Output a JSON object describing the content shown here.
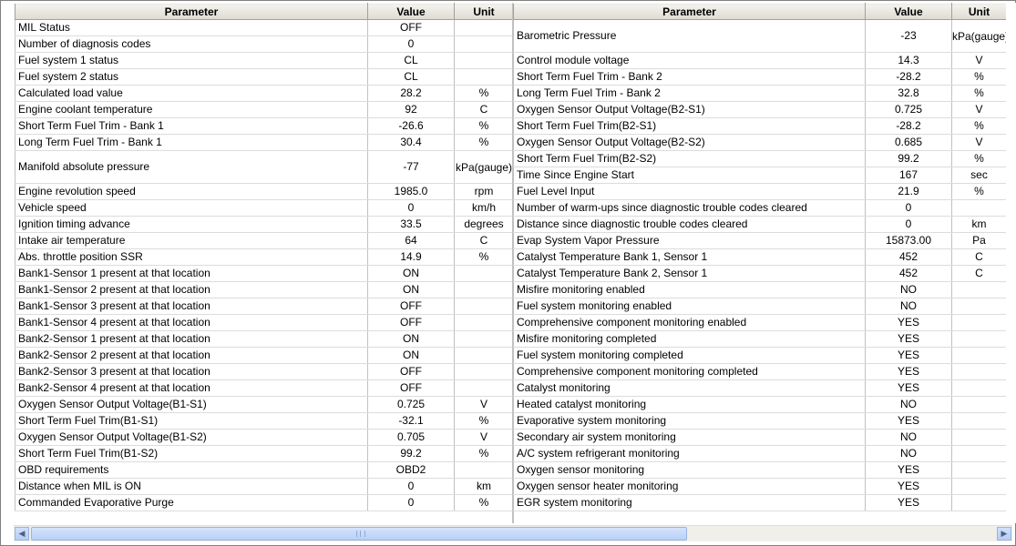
{
  "headers": {
    "parameter": "Parameter",
    "value": "Value",
    "unit": "Unit"
  },
  "left_rows": [
    {
      "p": "MIL Status",
      "v": "OFF",
      "u": ""
    },
    {
      "p": "Number of diagnosis codes",
      "v": "0",
      "u": ""
    },
    {
      "p": "Fuel system 1 status",
      "v": "CL",
      "u": ""
    },
    {
      "p": "Fuel system 2 status",
      "v": "CL",
      "u": ""
    },
    {
      "p": "Calculated load value",
      "v": "28.2",
      "u": "%"
    },
    {
      "p": "Engine coolant temperature",
      "v": "92",
      "u": "C"
    },
    {
      "p": "Short Term Fuel Trim - Bank 1",
      "v": "-26.6",
      "u": "%"
    },
    {
      "p": "Long Term Fuel Trim - Bank 1",
      "v": "30.4",
      "u": "%"
    },
    {
      "p": "Manifold absolute pressure",
      "v": "-77",
      "u": "kPa(gauge)",
      "tall": true
    },
    {
      "p": "Engine revolution speed",
      "v": "1985.0",
      "u": "rpm"
    },
    {
      "p": "Vehicle speed",
      "v": "0",
      "u": "km/h"
    },
    {
      "p": "Ignition timing advance",
      "v": "33.5",
      "u": "degrees"
    },
    {
      "p": "Intake air temperature",
      "v": "64",
      "u": "C"
    },
    {
      "p": "Abs. throttle position SSR",
      "v": "14.9",
      "u": "%"
    },
    {
      "p": "Bank1-Sensor 1 present at that location",
      "v": "ON",
      "u": ""
    },
    {
      "p": "Bank1-Sensor 2 present at that location",
      "v": "ON",
      "u": ""
    },
    {
      "p": "Bank1-Sensor 3 present at that location",
      "v": "OFF",
      "u": ""
    },
    {
      "p": "Bank1-Sensor 4 present at that location",
      "v": "OFF",
      "u": ""
    },
    {
      "p": "Bank2-Sensor 1 present at that location",
      "v": "ON",
      "u": ""
    },
    {
      "p": "Bank2-Sensor 2 present at that location",
      "v": "ON",
      "u": ""
    },
    {
      "p": "Bank2-Sensor 3 present at that location",
      "v": "OFF",
      "u": ""
    },
    {
      "p": "Bank2-Sensor 4 present at that location",
      "v": "OFF",
      "u": ""
    },
    {
      "p": "Oxygen Sensor Output Voltage(B1-S1)",
      "v": "0.725",
      "u": "V"
    },
    {
      "p": "Short Term Fuel Trim(B1-S1)",
      "v": "-32.1",
      "u": "%"
    },
    {
      "p": "Oxygen Sensor Output Voltage(B1-S2)",
      "v": "0.705",
      "u": "V"
    },
    {
      "p": "Short Term Fuel Trim(B1-S2)",
      "v": "99.2",
      "u": "%"
    },
    {
      "p": "OBD requirements",
      "v": "OBD2",
      "u": ""
    },
    {
      "p": "Distance when MIL is ON",
      "v": "0",
      "u": "km"
    },
    {
      "p": "Commanded Evaporative Purge",
      "v": "0",
      "u": "%"
    }
  ],
  "right_rows": [
    {
      "p": "Barometric Pressure",
      "v": "-23",
      "u": "kPa(gauge)",
      "tall": true
    },
    {
      "p": "Control module voltage",
      "v": "14.3",
      "u": "V"
    },
    {
      "p": "Short Term Fuel Trim - Bank 2",
      "v": "-28.2",
      "u": "%"
    },
    {
      "p": "Long Term Fuel Trim - Bank 2",
      "v": "32.8",
      "u": "%"
    },
    {
      "p": "Oxygen Sensor Output Voltage(B2-S1)",
      "v": "0.725",
      "u": "V"
    },
    {
      "p": "Short Term Fuel Trim(B2-S1)",
      "v": "-28.2",
      "u": "%"
    },
    {
      "p": "Oxygen Sensor Output Voltage(B2-S2)",
      "v": "0.685",
      "u": "V"
    },
    {
      "p": "Short Term Fuel Trim(B2-S2)",
      "v": "99.2",
      "u": "%"
    },
    {
      "p": "Time Since Engine Start",
      "v": "167",
      "u": "sec"
    },
    {
      "p": "Fuel Level Input",
      "v": "21.9",
      "u": "%"
    },
    {
      "p": "Number of warm-ups since diagnostic trouble codes cleared",
      "v": "0",
      "u": ""
    },
    {
      "p": "Distance since diagnostic trouble codes cleared",
      "v": "0",
      "u": "km"
    },
    {
      "p": "Evap System Vapor Pressure",
      "v": "15873.00",
      "u": "Pa"
    },
    {
      "p": "Catalyst Temperature Bank 1, Sensor 1",
      "v": "452",
      "u": "C"
    },
    {
      "p": "Catalyst Temperature Bank 2, Sensor 1",
      "v": "452",
      "u": "C"
    },
    {
      "p": "Misfire monitoring enabled",
      "v": "NO",
      "u": ""
    },
    {
      "p": "Fuel system monitoring enabled",
      "v": "NO",
      "u": ""
    },
    {
      "p": "Comprehensive component monitoring enabled",
      "v": "YES",
      "u": ""
    },
    {
      "p": "Misfire monitoring completed",
      "v": "YES",
      "u": ""
    },
    {
      "p": "Fuel system monitoring completed",
      "v": "YES",
      "u": ""
    },
    {
      "p": "Comprehensive component monitoring completed",
      "v": "YES",
      "u": ""
    },
    {
      "p": "Catalyst monitoring",
      "v": "YES",
      "u": ""
    },
    {
      "p": "Heated catalyst monitoring",
      "v": "NO",
      "u": ""
    },
    {
      "p": "Evaporative system monitoring",
      "v": "YES",
      "u": ""
    },
    {
      "p": "Secondary air system monitoring",
      "v": "NO",
      "u": ""
    },
    {
      "p": "A/C system refrigerant monitoring",
      "v": "NO",
      "u": ""
    },
    {
      "p": "Oxygen sensor monitoring",
      "v": "YES",
      "u": ""
    },
    {
      "p": "Oxygen sensor heater monitoring",
      "v": "YES",
      "u": ""
    },
    {
      "p": "EGR system monitoring",
      "v": "YES",
      "u": ""
    }
  ],
  "icons": {
    "scroll_left": "arrow-left-icon",
    "scroll_right": "arrow-right-icon"
  },
  "colors": {
    "scroll_accent": "#b9d0f6",
    "header_bg": "#e6e4dc"
  }
}
